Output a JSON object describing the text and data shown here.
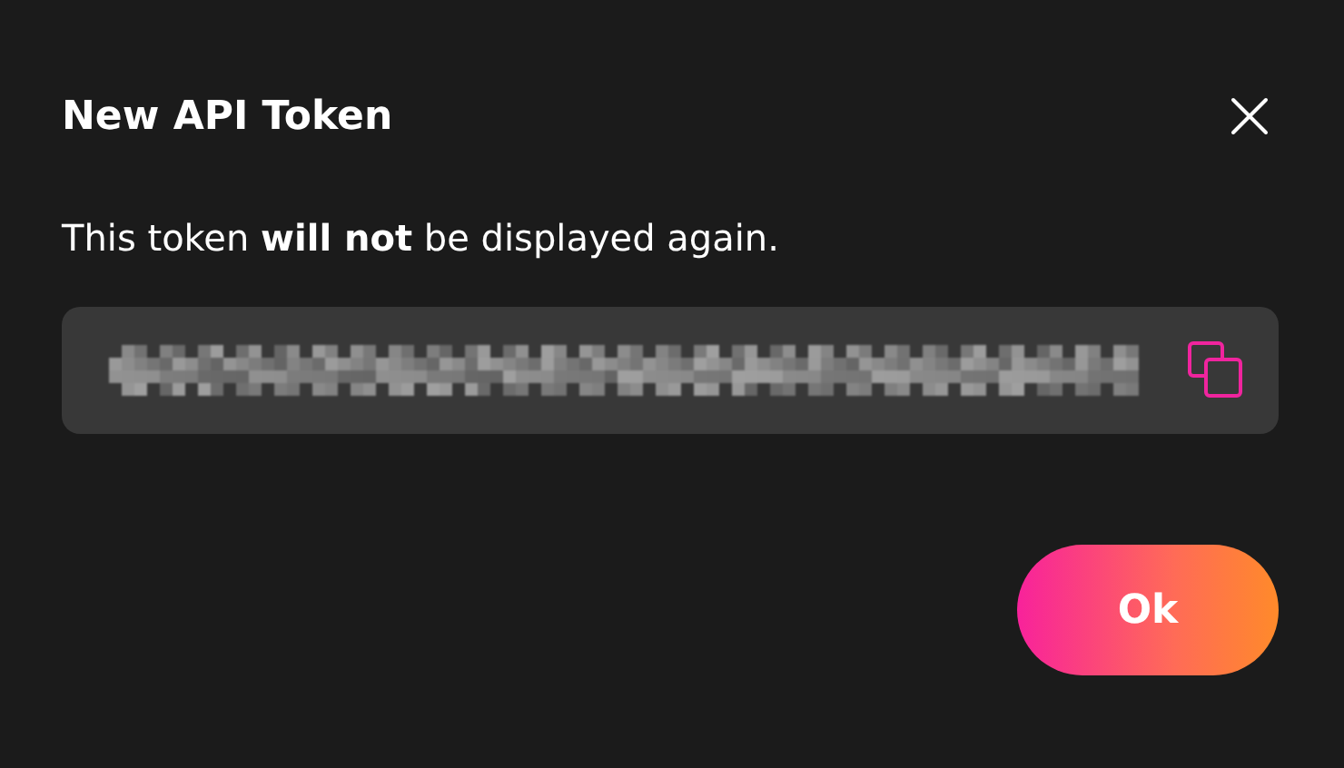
{
  "dialog": {
    "title": "New API Token",
    "message": "This token **will not** be displayed again.",
    "button": "Ok"
  }
}
